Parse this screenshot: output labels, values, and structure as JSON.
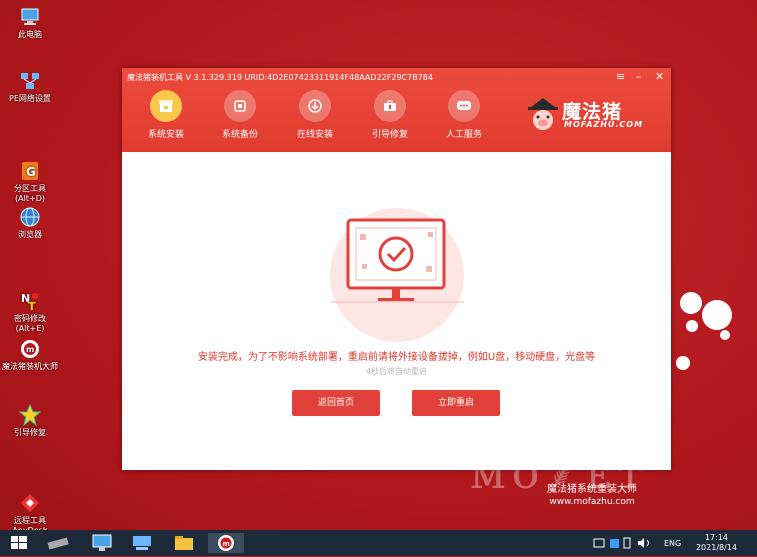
{
  "desktop": {
    "icons": [
      {
        "label": "此电脑"
      },
      {
        "label": "PE网络设置"
      },
      {
        "label": "分区工具\n(Alt+D)"
      },
      {
        "label": "浏览器"
      },
      {
        "label": "密码修改\n(Alt+E)"
      },
      {
        "label": "魔法猪装机大师"
      },
      {
        "label": "引导修复"
      },
      {
        "label": "远程工具\nAnyDesk"
      }
    ],
    "bg_brand_cn": "魔法猪系统重装大师",
    "bg_brand_en": "www.mofazhu.com"
  },
  "window": {
    "title": "魔法猪装机工具 V 3.1.329.319 URID:4D2E07423311914F48AAD22F29C7B784",
    "controls": {
      "menu": "≡",
      "minimize": "–",
      "close": "✕"
    },
    "nav": [
      {
        "label": "系统安装",
        "icon": "install-icon",
        "active": true
      },
      {
        "label": "系统备份",
        "icon": "backup-icon",
        "active": false
      },
      {
        "label": "在线安装",
        "icon": "download-icon",
        "active": false
      },
      {
        "label": "引导修复",
        "icon": "repair-icon",
        "active": false
      },
      {
        "label": "人工服务",
        "icon": "chat-icon",
        "active": false
      }
    ],
    "logo": {
      "cn": "魔法猪",
      "en": "MOFAZHU.COM"
    },
    "message": "安装完成，为了不影响系统部署，重启前请将外接设备拔掉，例如U盘，移动硬盘，光盘等",
    "countdown": "4秒后将自动重启",
    "buttons": {
      "home": "返回首页",
      "restart": "立即重启"
    },
    "colors": {
      "accent": "#e2403a",
      "title_bar": "#e8453a",
      "active_nav": "#f9c84a"
    }
  },
  "taskbar": {
    "lang": "ENG",
    "time": "17:14",
    "date": "2021/8/14"
  }
}
